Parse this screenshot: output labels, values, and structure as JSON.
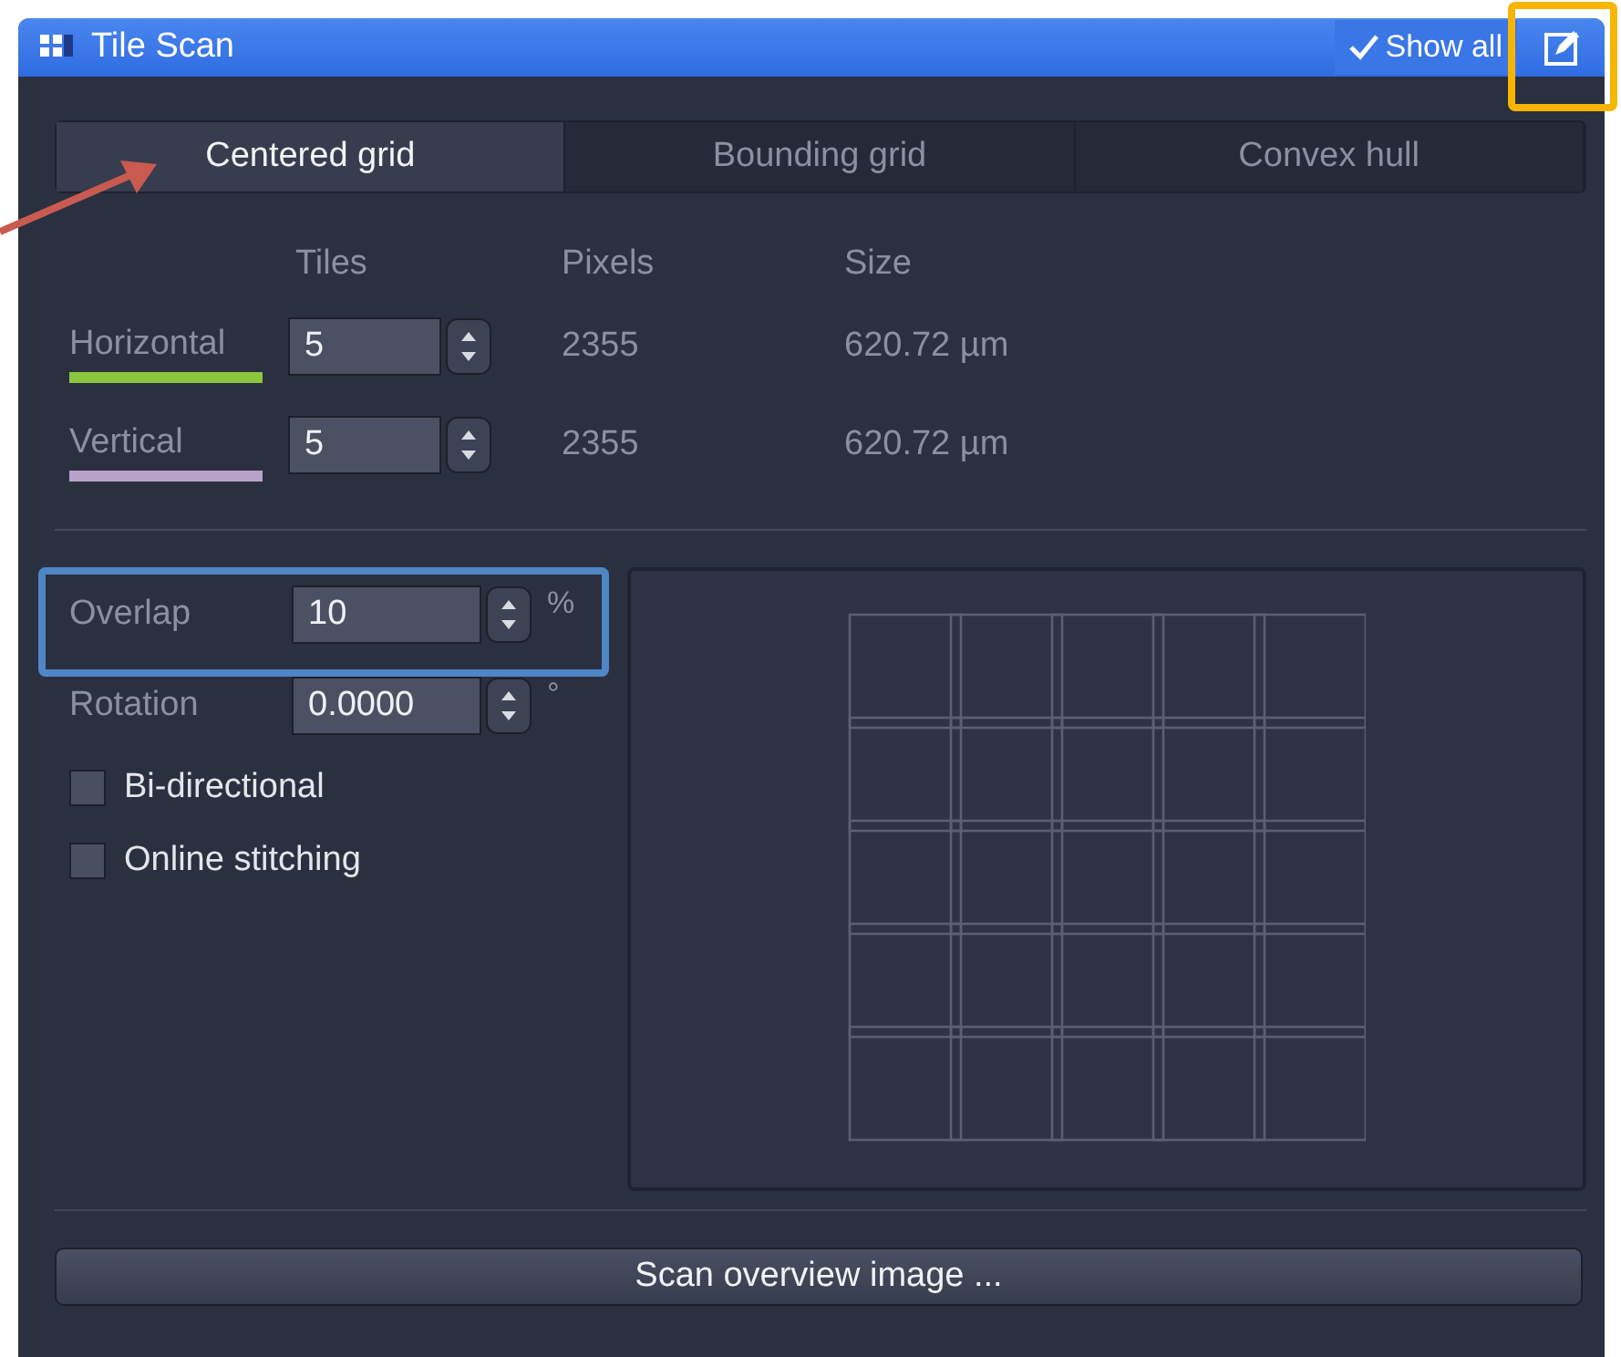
{
  "window": {
    "title": "Tile Scan",
    "show_all": {
      "label": "Show all",
      "checked": true
    }
  },
  "tabs": [
    {
      "label": "Centered grid",
      "selected": true
    },
    {
      "label": "Bounding grid",
      "selected": false
    },
    {
      "label": "Convex hull",
      "selected": false
    }
  ],
  "columns": [
    "Tiles",
    "Pixels",
    "Size"
  ],
  "rows": [
    {
      "label": "Horizontal",
      "value": "5",
      "pixels": "2355",
      "size": "620.72 µm",
      "color": "#8dc63f"
    },
    {
      "label": "Vertical",
      "value": "5",
      "pixels": "2355",
      "size": "620.72 µm",
      "color": "#b9a3c9"
    }
  ],
  "settings": [
    {
      "label": "Overlap",
      "value": "10",
      "unit": "%"
    },
    {
      "label": "Rotation",
      "value": "0.0000",
      "unit": "°"
    }
  ],
  "options": [
    {
      "label": "Bi-directional",
      "checked": false
    },
    {
      "label": "Online stitching",
      "checked": false
    }
  ],
  "action_button": "Scan overview image ..."
}
